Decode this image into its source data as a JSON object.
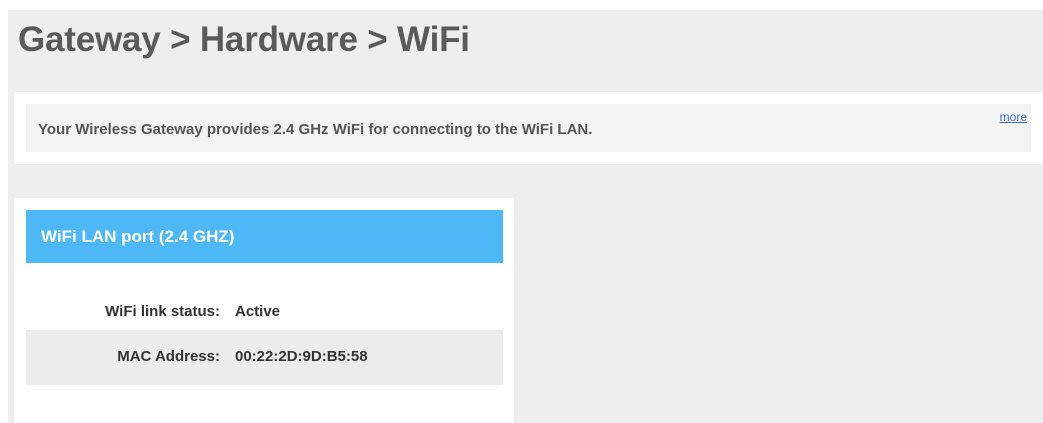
{
  "page": {
    "title": "Gateway > Hardware > WiFi"
  },
  "info": {
    "text": "Your Wireless Gateway provides 2.4 GHz WiFi for connecting to the WiFi LAN.",
    "more_label": "more"
  },
  "port": {
    "title": "WiFi LAN port (2.4 GHZ)",
    "fields": [
      {
        "label": "WiFi link status:",
        "value": "Active"
      },
      {
        "label": "MAC Address:",
        "value": "00:22:2D:9D:B5:58"
      }
    ]
  },
  "colors": {
    "page_background": "#eeeeee",
    "header_accent": "#4db8f5",
    "title_text": "#5a5a5a",
    "link": "#3a6ec8"
  }
}
